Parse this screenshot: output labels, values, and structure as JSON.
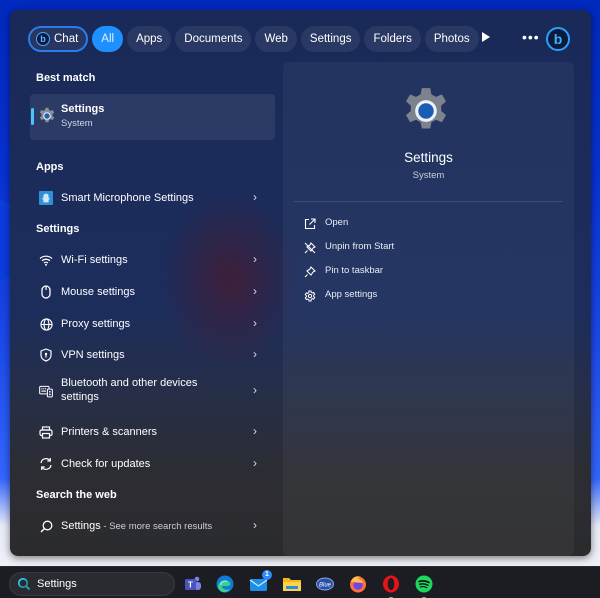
{
  "filter_bar": {
    "chat_label": "Chat",
    "tabs": [
      {
        "label": "All",
        "active": true
      },
      {
        "label": "Apps",
        "active": false
      },
      {
        "label": "Documents",
        "active": false
      },
      {
        "label": "Web",
        "active": false
      },
      {
        "label": "Settings",
        "active": false
      },
      {
        "label": "Folders",
        "active": false
      },
      {
        "label": "Photos",
        "active": false
      }
    ],
    "play_icon": "play-icon",
    "more_label": "•••",
    "bing_label": "b"
  },
  "left": {
    "best_match_heading": "Best match",
    "best_match": {
      "title": "Settings",
      "subtitle": "System",
      "icon": "settings-gear-icon"
    },
    "apps_heading": "Apps",
    "apps": [
      {
        "label": "Smart Microphone Settings",
        "icon": "smart-microphone-icon"
      }
    ],
    "settings_heading": "Settings",
    "settings": [
      {
        "label": "Wi-Fi settings",
        "icon": "wifi-icon"
      },
      {
        "label": "Mouse settings",
        "icon": "mouse-icon"
      },
      {
        "label": "Proxy settings",
        "icon": "globe-icon"
      },
      {
        "label": "VPN settings",
        "icon": "shield-icon"
      },
      {
        "label": "Bluetooth and other devices settings",
        "icon": "devices-icon"
      },
      {
        "label": "Printers & scanners",
        "icon": "printer-icon"
      },
      {
        "label": "Check for updates",
        "icon": "refresh-icon"
      }
    ],
    "web_heading": "Search the web",
    "web": {
      "query": "Settings",
      "suffix": " - See more search results",
      "icon": "search-icon"
    },
    "chevron": "›"
  },
  "right": {
    "title": "Settings",
    "subtitle": "System",
    "actions": [
      {
        "label": "Open",
        "icon": "open-external-icon"
      },
      {
        "label": "Unpin from Start",
        "icon": "unpin-icon"
      },
      {
        "label": "Pin to taskbar",
        "icon": "pin-icon"
      },
      {
        "label": "App settings",
        "icon": "gear-icon"
      }
    ]
  },
  "taskbar": {
    "search_value": "Settings",
    "apps": [
      {
        "name": "Microsoft Teams"
      },
      {
        "name": "Microsoft Edge"
      },
      {
        "name": "Mail",
        "badge": "1"
      },
      {
        "name": "File Explorer"
      },
      {
        "name": "Blue app"
      },
      {
        "name": "Firefox"
      },
      {
        "name": "Opera",
        "running": true
      },
      {
        "name": "Spotify",
        "running": true
      }
    ]
  },
  "colors": {
    "accent": "#1e90ff",
    "selection_bar": "#4cc2ff",
    "desktop": "#0029bd"
  }
}
